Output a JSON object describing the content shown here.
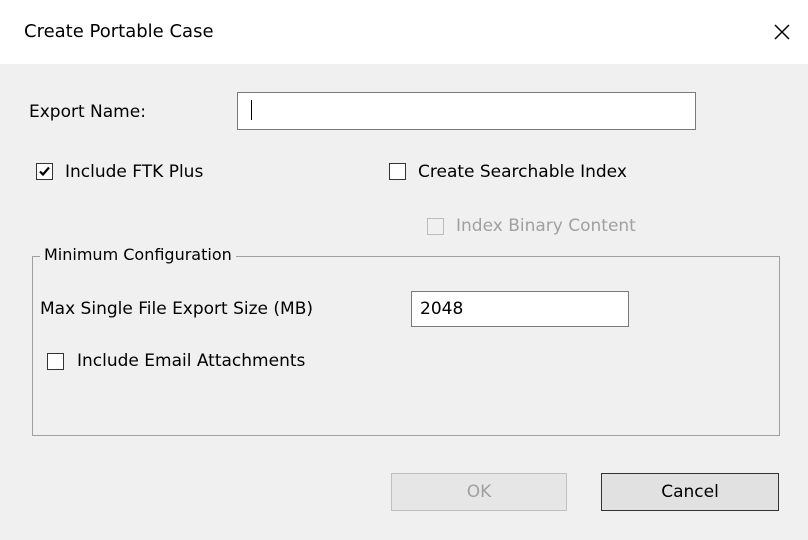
{
  "window": {
    "title": "Create Portable Case",
    "close_icon": "close-icon"
  },
  "export_name": {
    "label": "Export Name:",
    "value": ""
  },
  "options": {
    "include_ftk_plus": {
      "label": "Include FTK Plus",
      "checked": true,
      "enabled": true
    },
    "create_searchable_index": {
      "label": "Create Searchable Index",
      "checked": false,
      "enabled": true
    },
    "index_binary_content": {
      "label": "Index Binary Content",
      "checked": false,
      "enabled": false
    }
  },
  "minimum_configuration": {
    "legend": "Minimum Configuration",
    "max_file_size_label": "Max Single File Export Size (MB)",
    "max_file_size_value": "2048",
    "include_email_attachments": {
      "label": "Include Email Attachments",
      "checked": false,
      "enabled": true
    }
  },
  "buttons": {
    "ok": {
      "label": "OK",
      "enabled": false
    },
    "cancel": {
      "label": "Cancel",
      "enabled": true
    }
  }
}
